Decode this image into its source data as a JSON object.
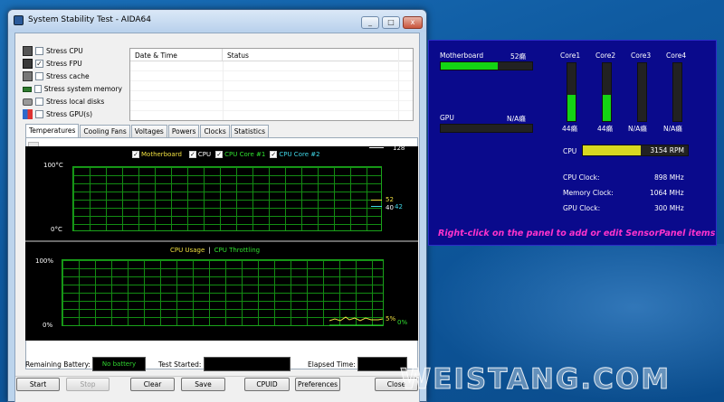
{
  "window": {
    "title": "System Stability Test - AIDA64",
    "controls": {
      "minimize": "_",
      "maximize": "□",
      "close": "x"
    }
  },
  "stress_options": [
    {
      "label": "Stress CPU",
      "checked": false,
      "icon": "cpu-icon"
    },
    {
      "label": "Stress FPU",
      "checked": true,
      "icon": "fpu-icon"
    },
    {
      "label": "Stress cache",
      "checked": false,
      "icon": "cache-icon"
    },
    {
      "label": "Stress system memory",
      "checked": false,
      "icon": "memory-icon"
    },
    {
      "label": "Stress local disks",
      "checked": false,
      "icon": "disk-icon"
    },
    {
      "label": "Stress GPU(s)",
      "checked": false,
      "icon": "gpu-icon"
    }
  ],
  "log_table": {
    "columns": [
      "Date & Time",
      "Status"
    ],
    "rows": []
  },
  "tabs": [
    {
      "label": "Temperatures",
      "active": true
    },
    {
      "label": "Cooling Fans",
      "active": false
    },
    {
      "label": "Voltages",
      "active": false
    },
    {
      "label": "Powers",
      "active": false
    },
    {
      "label": "Clocks",
      "active": false
    },
    {
      "label": "Statistics",
      "active": false
    }
  ],
  "temp_graph": {
    "legend": [
      {
        "label": "Motherboard",
        "checked": true,
        "color": "#f0e040"
      },
      {
        "label": "CPU",
        "checked": true,
        "color": "#ffffff"
      },
      {
        "label": "CPU Core #1",
        "checked": true,
        "color": "#30e030"
      },
      {
        "label": "CPU Core #2",
        "checked": true,
        "color": "#40d8e8"
      }
    ],
    "y_top": "100°C",
    "y_bottom": "0°C",
    "scroll_top_value": "128",
    "current_values": {
      "motherboard": "52",
      "cpu": "40",
      "core": "42"
    }
  },
  "usage_graph": {
    "legend": [
      {
        "label": "CPU Usage",
        "color": "#f0e040"
      },
      {
        "label": "CPU Throttling",
        "color": "#30e030"
      }
    ],
    "separator": "|",
    "y_top": "100%",
    "y_bottom": "0%",
    "current_values": {
      "usage": "5%",
      "throttling": "0%"
    }
  },
  "status": {
    "battery_label": "Remaining Battery:",
    "battery_value": "No battery",
    "started_label": "Test Started:",
    "started_value": "",
    "elapsed_label": "Elapsed Time:",
    "elapsed_value": ""
  },
  "buttons": {
    "start": "Start",
    "stop": "Stop",
    "clear": "Clear",
    "save": "Save",
    "cpuid": "CPUID",
    "preferences": "Preferences",
    "close": "Close"
  },
  "sensor_panel": {
    "background": "#0a0a8c",
    "motherboard": {
      "label": "Motherboard",
      "value": "52癩",
      "fill_fraction": 0.62
    },
    "gpu": {
      "label": "GPU",
      "value": "N/A癩",
      "fill_fraction": 0
    },
    "cores": [
      {
        "label": "Core1",
        "value": "44癩",
        "fill_fraction": 0.45
      },
      {
        "label": "Core2",
        "value": "44癩",
        "fill_fraction": 0.45
      },
      {
        "label": "Core3",
        "value": "N/A癩",
        "fill_fraction": 0
      },
      {
        "label": "Core4",
        "value": "N/A癩",
        "fill_fraction": 0
      }
    ],
    "cpu_fan": {
      "label": "CPU",
      "value": "3154 RPM",
      "fill_fraction": 0.55,
      "color": "#d8d820"
    },
    "clocks": [
      {
        "label": "CPU Clock:",
        "value": "898 MHz"
      },
      {
        "label": "Memory Clock:",
        "value": "1064 MHz"
      },
      {
        "label": "GPU Clock:",
        "value": "300 MHz"
      }
    ],
    "hint": "Right-click on the panel to add or edit SensorPanel items"
  },
  "watermark": "WEISTANG.COM"
}
